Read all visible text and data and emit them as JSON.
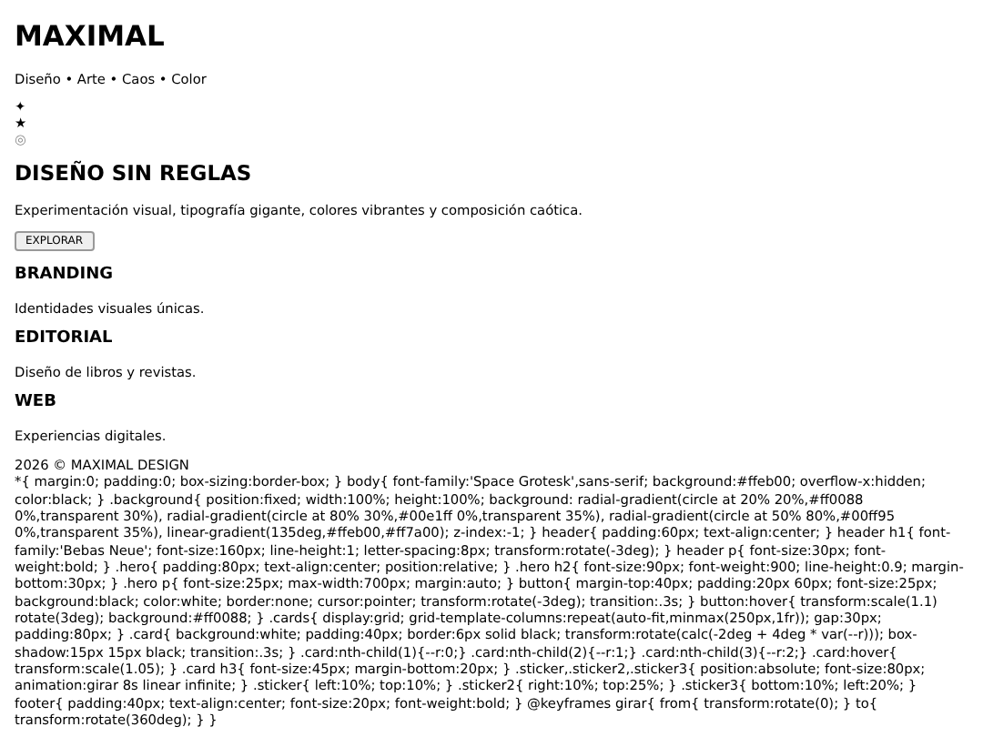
{
  "header": {
    "title": "MAXIMAL",
    "tagline": "Diseño • Arte • Caos • Color"
  },
  "stickers": [
    "✦",
    "★",
    "◎"
  ],
  "hero": {
    "title": "DISEÑO SIN REGLAS",
    "text": "Experimentación visual, tipografía gigante, colores vibrantes y composición caótica.",
    "button": "EXPLORAR"
  },
  "cards": [
    {
      "title": "BRANDING",
      "text": "Identidades visuales únicas."
    },
    {
      "title": "EDITORIAL",
      "text": "Diseño de libros y revistas."
    },
    {
      "title": "WEB",
      "text": "Experiencias digitales."
    }
  ],
  "footer": "2026 © MAXIMAL DESIGN",
  "style_text": "*{ margin:0; padding:0; box-sizing:border-box; } body{ font-family:'Space Grotesk',sans-serif; background:#ffeb00; overflow-x:hidden; color:black; } .background{ position:fixed; width:100%; height:100%; background: radial-gradient(circle at 20% 20%,#ff0088 0%,transparent 30%), radial-gradient(circle at 80% 30%,#00e1ff 0%,transparent 35%), radial-gradient(circle at 50% 80%,#00ff95 0%,transparent 35%), linear-gradient(135deg,#ffeb00,#ff7a00); z-index:-1; } header{ padding:60px; text-align:center; } header h1{ font-family:'Bebas Neue'; font-size:160px; line-height:1; letter-spacing:8px; transform:rotate(-3deg); } header p{ font-size:30px; font-weight:bold; } .hero{ padding:80px; text-align:center; position:relative; } .hero h2{ font-size:90px; font-weight:900; line-height:0.9; margin-bottom:30px; } .hero p{ font-size:25px; max-width:700px; margin:auto; } button{ margin-top:40px; padding:20px 60px; font-size:25px; background:black; color:white; border:none; cursor:pointer; transform:rotate(-3deg); transition:.3s; } button:hover{ transform:scale(1.1) rotate(3deg); background:#ff0088; } .cards{ display:grid; grid-template-columns:repeat(auto-fit,minmax(250px,1fr)); gap:30px; padding:80px; } .card{ background:white; padding:40px; border:6px solid black; transform:rotate(calc(-2deg + 4deg * var(--r))); box-shadow:15px 15px black; transition:.3s; } .card:nth-child(1){--r:0;} .card:nth-child(2){--r:1;} .card:nth-child(3){--r:2;} .card:hover{ transform:scale(1.05); } .card h3{ font-size:45px; margin-bottom:20px; } .sticker,.sticker2,.sticker3{ position:absolute; font-size:80px; animation:girar 8s linear infinite; } .sticker{ left:10%; top:10%; } .sticker2{ right:10%; top:25%; } .sticker3{ bottom:10%; left:20%; } footer{ padding:40px; text-align:center; font-size:20px; font-weight:bold; } @keyframes girar{ from{ transform:rotate(0); } to{ transform:rotate(360deg); } }"
}
